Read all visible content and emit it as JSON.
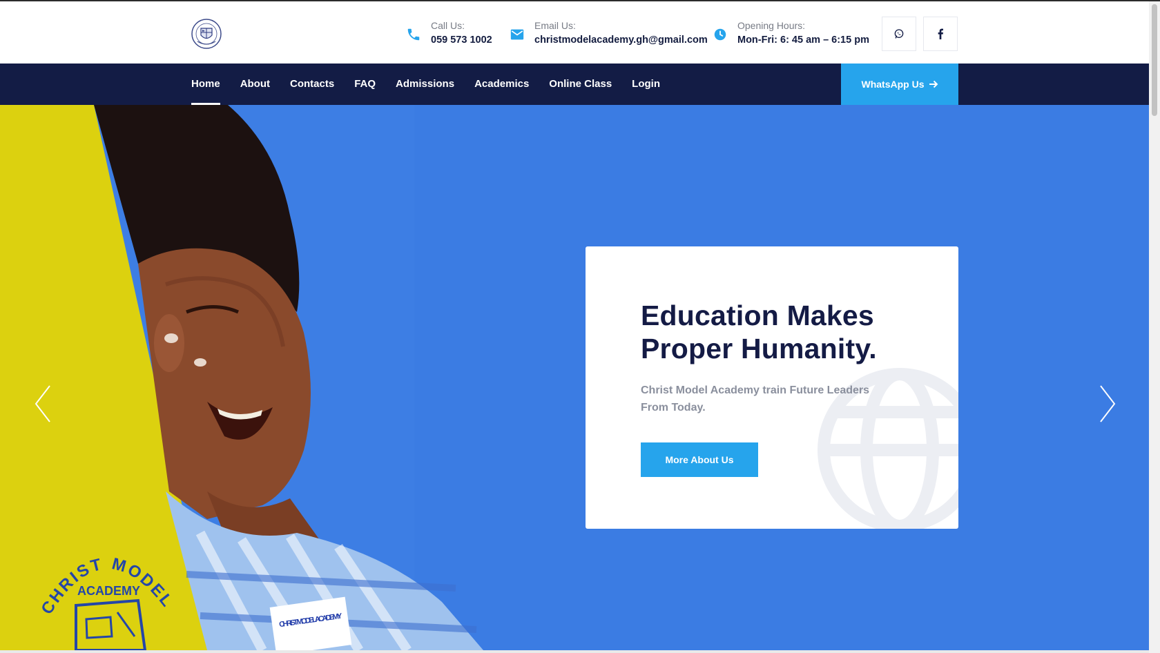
{
  "header": {
    "call": {
      "label": "Call Us:",
      "value": "059 573 1002",
      "icon": "phone-icon"
    },
    "email": {
      "label": "Email Us:",
      "value": "christmodelacademy.gh@gmail.com",
      "icon": "mail-icon"
    },
    "hours": {
      "label": "Opening Hours:",
      "value": "Mon-Fri: 6: 45 am – 6:15 pm",
      "icon": "clock-icon"
    },
    "social": [
      "whatsapp-icon",
      "facebook-icon"
    ]
  },
  "nav": {
    "items": [
      {
        "label": "Home",
        "active": true
      },
      {
        "label": "About"
      },
      {
        "label": "Contacts"
      },
      {
        "label": "FAQ"
      },
      {
        "label": "Admissions"
      },
      {
        "label": "Academics"
      },
      {
        "label": "Online Class"
      },
      {
        "label": "Login"
      }
    ],
    "cta": "WhatsApp Us"
  },
  "hero": {
    "title_line1": "Education Makes",
    "title_line2": "Proper Humanity.",
    "subtitle": "Christ Model Academy train Future Leaders From Today.",
    "button": "More About Us",
    "badge_line1": "CHRIST MODEL",
    "badge_line2": "ACADEMY",
    "uniform_text": "CHRIST MODEL ACADEMY"
  },
  "colors": {
    "navy": "#131c45",
    "accent": "#26a4ec",
    "hero_blue": "#3d7ee4",
    "yellow": "#dcd10f"
  }
}
